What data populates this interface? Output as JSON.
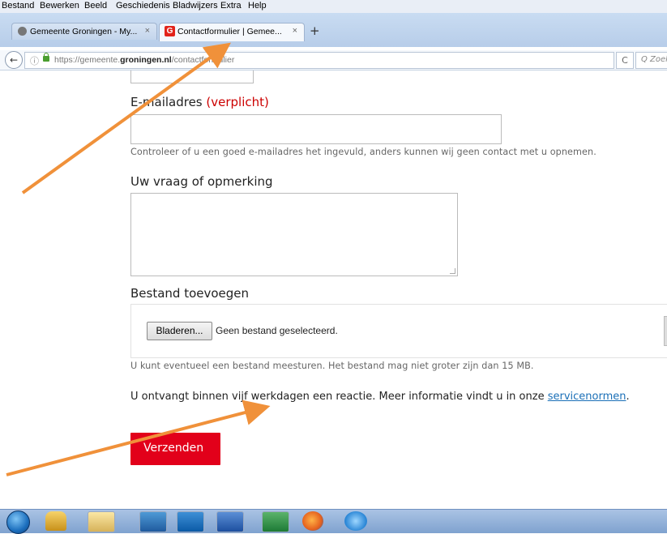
{
  "menubar": {
    "items": [
      "Bestand",
      "Bewerken",
      "Beeld",
      "Geschiedenis",
      "Bladwijzers",
      "Extra",
      "Help"
    ]
  },
  "tabs": [
    {
      "label": "Gemeente Groningen - My...",
      "close": "×"
    },
    {
      "label": "Contactformulier | Gemee...",
      "close": "×",
      "favicon": "G"
    }
  ],
  "newtab_label": "+",
  "navbar": {
    "back_icon": "←",
    "url_prefix": "https://gemeente.",
    "url_domain": "groningen.nl",
    "url_path": "/contactformulier",
    "reload_icon": "C",
    "search_placeholder": "Q Zoeken"
  },
  "form": {
    "email_label": "E-mailadres",
    "email_required": "(verplicht)",
    "email_help": "Controleer of u een goed e-mailadres het ingevuld, anders kunnen wij geen contact met u opnemen.",
    "question_label": "Uw vraag of opmerking",
    "file_label": "Bestand toevoegen",
    "browse_label": "Bladeren...",
    "no_file": "Geen bestand geselecteerd.",
    "file_help": "U kunt eventueel een bestand meesturen. Het bestand mag niet groter zijn dan 15 MB.",
    "info_text": "U ontvangt binnen vijf werkdagen een reactie. Meer informatie vindt u in onze ",
    "info_link": "servicenormen",
    "info_end": ".",
    "submit_label": "Verzenden"
  },
  "colors": {
    "accent_red": "#e2001a",
    "required_red": "#cc0000",
    "link_blue": "#1a6fb7",
    "annotation_arrow": "#f0913a"
  },
  "taskbar": {
    "icons": [
      "windows-start-icon",
      "lock-icon",
      "file-explorer-icon",
      "zip-icon",
      "outlook-icon",
      "word-icon",
      "excel-icon",
      "firefox-icon",
      "internet-explorer-icon"
    ]
  }
}
